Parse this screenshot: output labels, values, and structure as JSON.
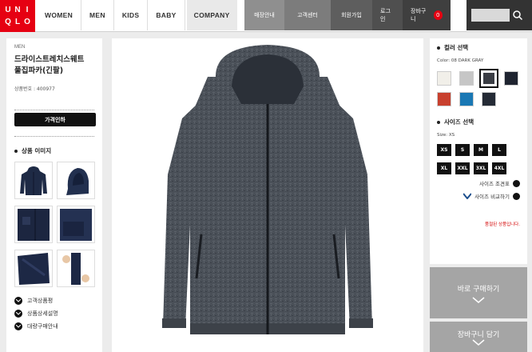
{
  "header": {
    "logo": [
      "U",
      "N",
      "I",
      "Q",
      "L",
      "O"
    ],
    "nav": [
      "WOMEN",
      "MEN",
      "KIDS",
      "BABY",
      "COMPANY"
    ],
    "utility": [
      "매장안내",
      "고객센터",
      "회원가입",
      "로그인",
      "장바구니"
    ],
    "cart_count": "0",
    "search": {
      "placeholder": ""
    }
  },
  "product": {
    "category": "MEN",
    "title_line1": "드라이스트레치스웨트",
    "title_line2": "풀집파카(긴팔)",
    "product_no": "상품번호 : 400977",
    "price_button": "가격인하",
    "images_title": "상품 이미지"
  },
  "left_links": [
    "고객상품평",
    "상품상세설명",
    "대량구매안내"
  ],
  "options": {
    "color_title": "컬러 선택",
    "color_label": "Color: 08 DARK GRAY",
    "colors": [
      "#f1efe9",
      "#c6c6c6",
      "#3a3d44",
      "#1f2430",
      "#c8402e",
      "#1a78b4",
      "#252b36"
    ],
    "size_title": "사이즈 선택",
    "size_label": "Size: XS",
    "sizes": [
      "XS",
      "S",
      "M",
      "L",
      "XL",
      "XXL",
      "3XL",
      "4XL"
    ],
    "size_guide": "사이즈 조견표",
    "size_compare": "사이즈 비교하기",
    "notice": "품절된 상품입니다."
  },
  "actions": {
    "buy_now": "바로 구매하기",
    "add_cart": "장바구니 담기"
  },
  "colors": {
    "brand": "#e60012",
    "accent_red": "#d40000"
  }
}
